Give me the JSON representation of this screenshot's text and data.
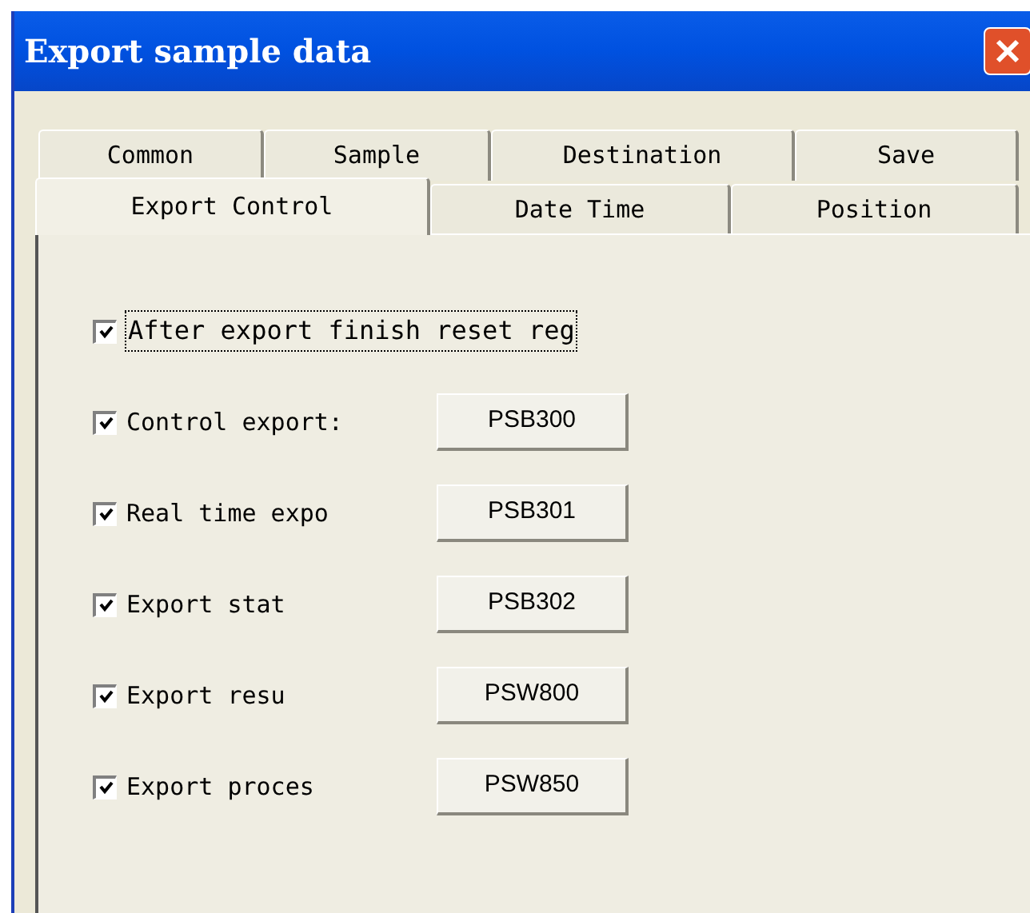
{
  "window": {
    "title": "Export sample data"
  },
  "tab_rows": [
    [
      {
        "label": "Common",
        "selected": false
      },
      {
        "label": "Sample",
        "selected": false
      },
      {
        "label": "Destination",
        "selected": false
      },
      {
        "label": "Save",
        "selected": false
      }
    ],
    [
      {
        "label": "Export Control",
        "selected": true
      },
      {
        "label": "Date Time",
        "selected": false
      },
      {
        "label": "Position",
        "selected": false
      }
    ]
  ],
  "options": [
    {
      "kind": "checkbox",
      "label": "After export finish reset reg",
      "checked": true,
      "focused": true
    },
    {
      "kind": "register",
      "label": "Control export:",
      "checked": true,
      "button": "PSB300"
    },
    {
      "kind": "register",
      "label": "Real time expo",
      "checked": true,
      "button": "PSB301"
    },
    {
      "kind": "register",
      "label": "Export stat",
      "checked": true,
      "button": "PSB302"
    },
    {
      "kind": "register",
      "label": "Export resu",
      "checked": true,
      "button": "PSW800"
    },
    {
      "kind": "register",
      "label": "Export proces",
      "checked": true,
      "button": "PSW850"
    }
  ]
}
